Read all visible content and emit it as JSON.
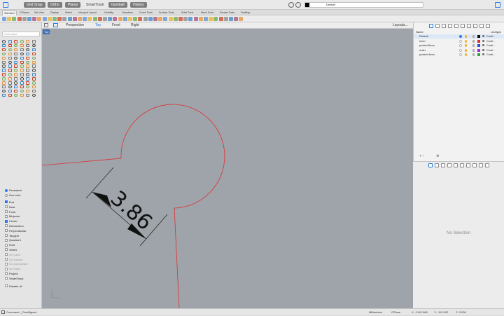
{
  "topbar": {
    "modes": [
      "Grid Snap",
      "Ortho",
      "Planar",
      "SmartTrack",
      "Gumball",
      "History"
    ],
    "layer_label": "Default"
  },
  "tabs": [
    "Standard",
    "CPlanes",
    "Set View",
    "Display",
    "Select",
    "Viewport Layout",
    "Visibility",
    "Transform",
    "Curve Tools",
    "Surface Tools",
    "Solid Tools",
    "Mesh Tools",
    "Render Tools",
    "Drafting"
  ],
  "viewtabs": {
    "perspective": "Perspective",
    "top": "Top",
    "front": "Front",
    "right": "Right",
    "layouts": "Layouts..."
  },
  "command": {
    "placeholder": "Command"
  },
  "snaps": {
    "persistent": "Persistent",
    "one_shot": "One shot",
    "items": [
      {
        "label": "End",
        "on": true,
        "dim": false
      },
      {
        "label": "Near",
        "on": false,
        "dim": false
      },
      {
        "label": "Point",
        "on": false,
        "dim": false
      },
      {
        "label": "Midpoint",
        "on": false,
        "dim": false
      },
      {
        "label": "Center",
        "on": true,
        "dim": false
      },
      {
        "label": "Intersection",
        "on": false,
        "dim": false
      },
      {
        "label": "Perpendicular",
        "on": false,
        "dim": false
      },
      {
        "label": "Tangent",
        "on": false,
        "dim": false
      },
      {
        "label": "Quadrant",
        "on": false,
        "dim": false
      },
      {
        "label": "Knot",
        "on": false,
        "dim": false
      },
      {
        "label": "Vertex",
        "on": false,
        "dim": false
      },
      {
        "label": "On curve",
        "on": false,
        "dim": true
      },
      {
        "label": "On surface",
        "on": false,
        "dim": true
      },
      {
        "label": "On polysurface",
        "on": false,
        "dim": true
      },
      {
        "label": "On mesh",
        "on": false,
        "dim": true
      },
      {
        "label": "Project",
        "on": false,
        "dim": false
      },
      {
        "label": "SmartTrack",
        "on": false,
        "dim": false
      }
    ],
    "disable_all": "Disable all"
  },
  "viewport": {
    "label": "Top",
    "dimension_text": "3.86",
    "accent": "#e03030"
  },
  "layers": {
    "header_name": "Name",
    "header_linetype": "Linetype",
    "rows": [
      {
        "name": "Default",
        "current": true,
        "color": "#111111",
        "linetype": "Conti..."
      },
      {
        "name": "inner",
        "current": false,
        "color": "#d93030",
        "linetype": "Conti..."
      },
      {
        "name": "pocket 5mm",
        "current": false,
        "color": "#2f4fd8",
        "linetype": "Conti..."
      },
      {
        "name": "outer",
        "current": false,
        "color": "#9a2fd8",
        "linetype": "Conti..."
      },
      {
        "name": "pocket 4mm",
        "current": false,
        "color": "#2aa83c",
        "linetype": "Conti..."
      }
    ]
  },
  "properties": {
    "empty": "No Selection"
  },
  "status": {
    "command": "Command: _DimAligned",
    "units": "Millimeters",
    "cplane": "CPlane",
    "x": "X: -1142.068",
    "y": "Y: -112.002",
    "z": "Z: 0.000"
  }
}
